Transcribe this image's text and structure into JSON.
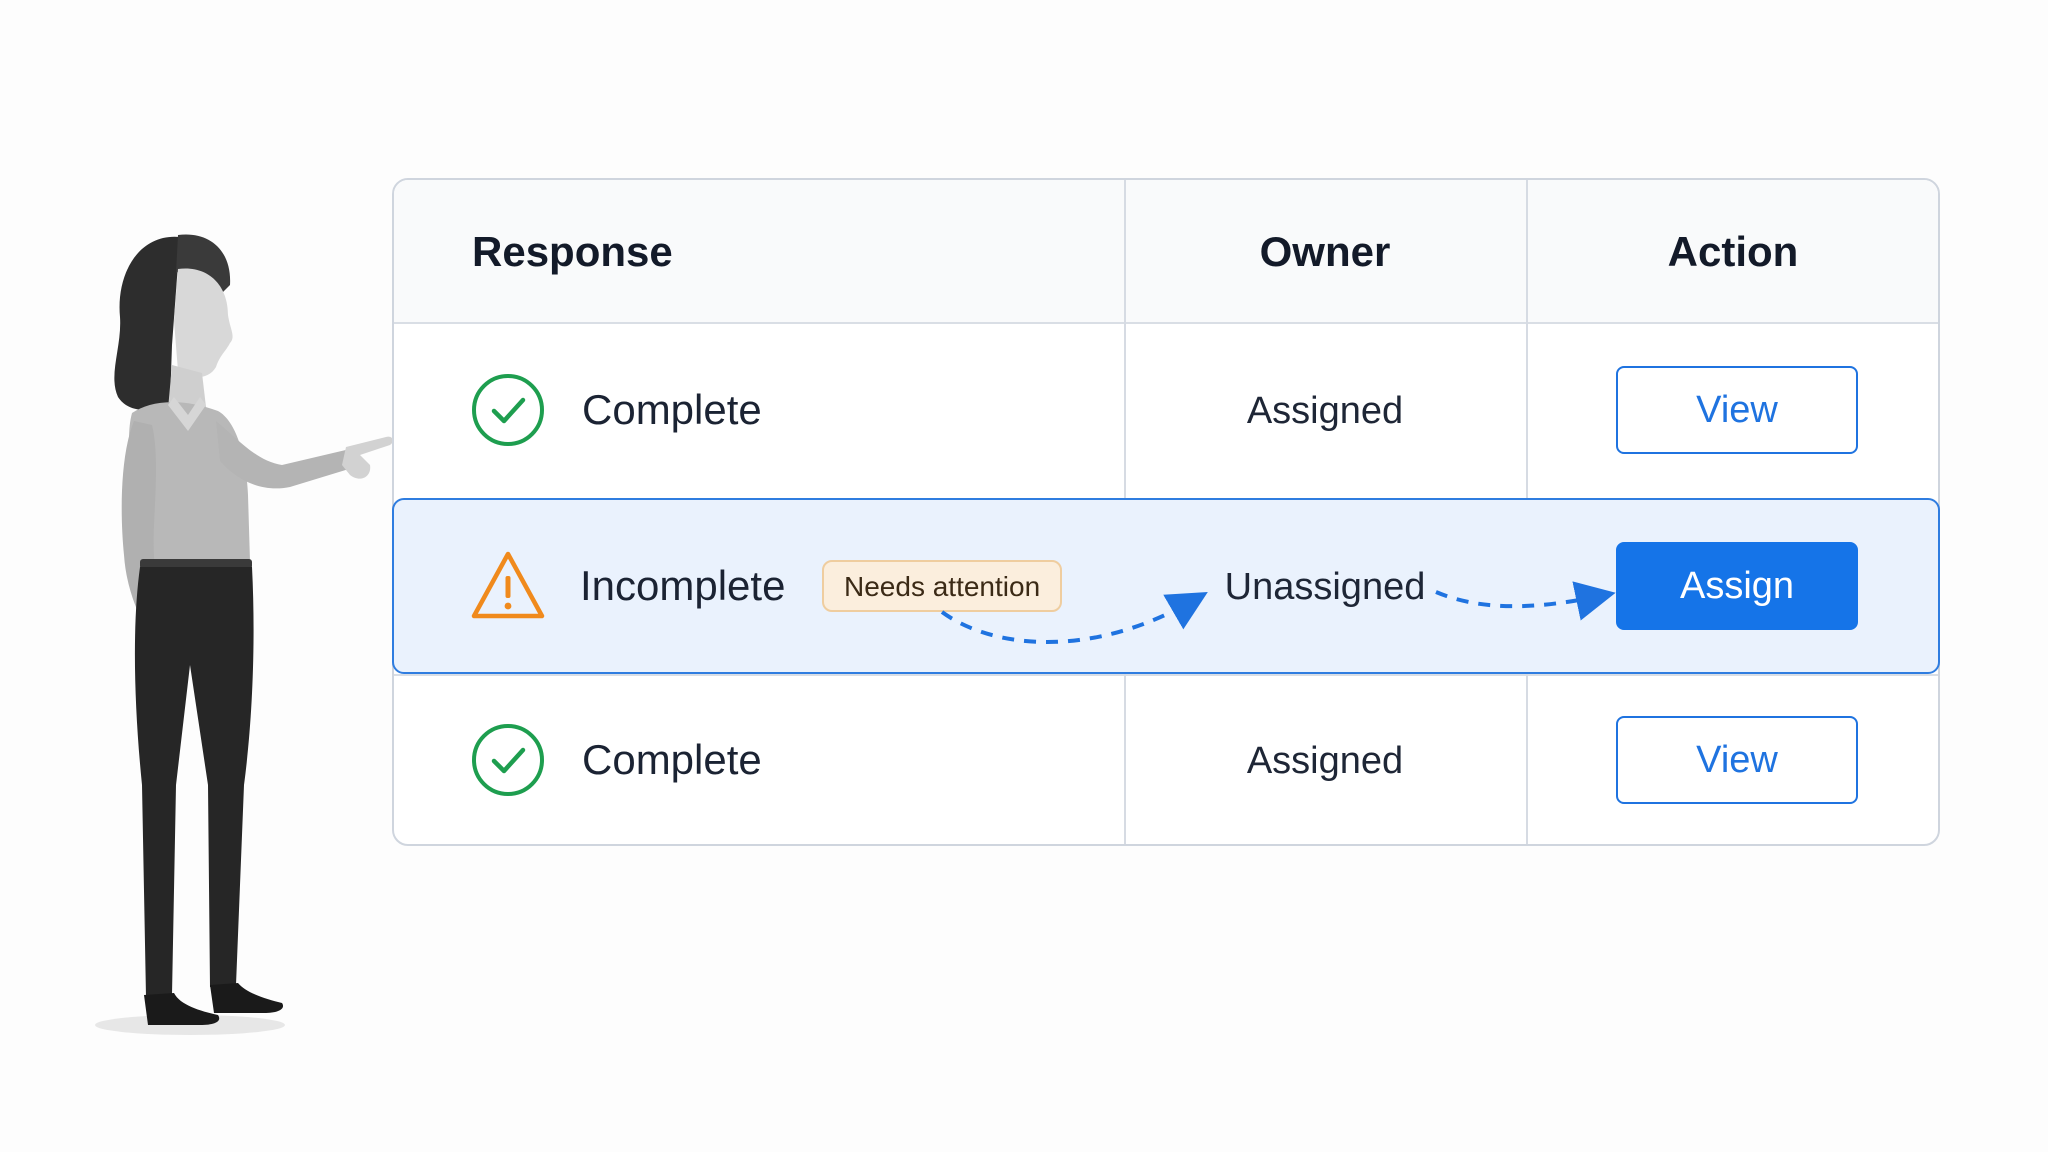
{
  "table": {
    "headers": {
      "response": "Response",
      "owner": "Owner",
      "action": "Action"
    },
    "rows": [
      {
        "status_icon": "check-circle-icon",
        "status": "Complete",
        "owner": "Assigned",
        "action": "View"
      },
      {
        "status_icon": "warning-triangle-icon",
        "status": "Incomplete",
        "badge": "Needs attention",
        "owner": "Unassigned",
        "action": "Assign"
      },
      {
        "status_icon": "check-circle-icon",
        "status": "Complete",
        "owner": "Assigned",
        "action": "View"
      }
    ]
  },
  "colors": {
    "complete": "#1e9e4f",
    "warning": "#f08a1c",
    "accent": "#1574e8",
    "highlight_bg": "#eaf2fd",
    "badge_bg": "#fbeedd"
  }
}
